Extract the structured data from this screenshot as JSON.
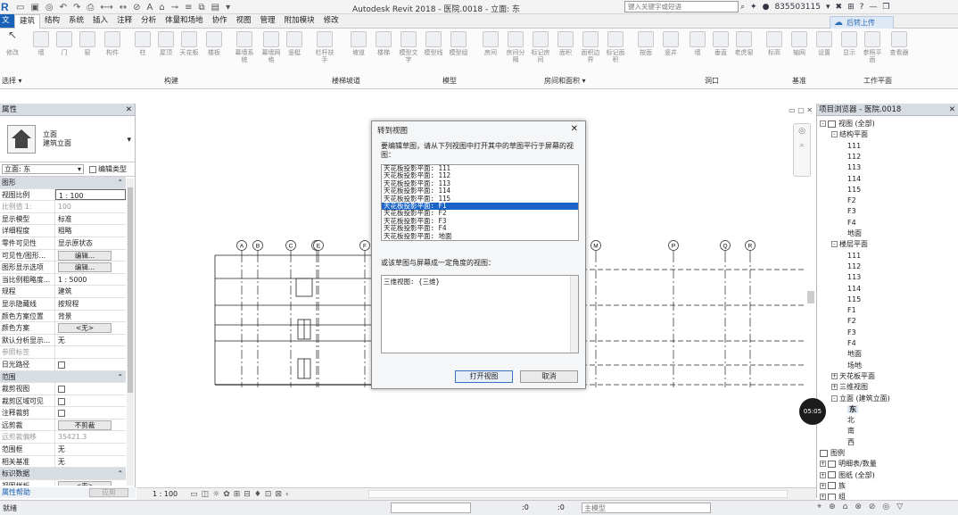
{
  "app": {
    "title": "Autodesk Revit 2018 -  医院.0018 - 立面: 东",
    "search_placeholder": "键入关键字或短语",
    "user": "835503115",
    "upload_label": "后转上传"
  },
  "tabs": [
    "建筑",
    "结构",
    "系统",
    "插入",
    "注释",
    "分析",
    "体量和场地",
    "协作",
    "视图",
    "管理",
    "附加模块",
    "修改"
  ],
  "active_tab_index": 0,
  "ribbon": {
    "modify": "修改",
    "buttons": [
      "墙",
      "门",
      "窗",
      "构件",
      "柱",
      "屋顶",
      "天花板",
      "楼板",
      "幕墙系统",
      "幕墙网格",
      "竖梃",
      "栏杆扶手",
      "坡道",
      "楼梯",
      "模型文字",
      "模型线",
      "模型组",
      "房间",
      "房间分隔",
      "标记房间",
      "面积",
      "面积边界",
      "标记面积",
      "按面",
      "竖井",
      "墙",
      "垂直",
      "老虎窗",
      "标高",
      "轴网",
      "设置",
      "显示",
      "参照平面",
      "查看器"
    ],
    "panels": [
      "选择 ▾",
      "构建",
      "楼梯坡道",
      "模型",
      "房间和面积 ▾",
      "洞口",
      "基准",
      "工作平面"
    ]
  },
  "properties": {
    "title": "属性",
    "type_name": "立面",
    "type_sub": "建筑立面",
    "instance": "立面: 东",
    "edit_type": "编辑类型",
    "rows": [
      {
        "k": "图形",
        "v": "",
        "kind": "sec"
      },
      {
        "k": "视图比例",
        "v": "1 : 100"
      },
      {
        "k": "比例值 1:",
        "v": "100",
        "kind": "grey"
      },
      {
        "k": "显示模型",
        "v": "标准"
      },
      {
        "k": "详细程度",
        "v": "粗略"
      },
      {
        "k": "零件可见性",
        "v": "显示原状态"
      },
      {
        "k": "可见性/图形...",
        "v": "编辑...",
        "kind": "btn"
      },
      {
        "k": "图形显示选项",
        "v": "编辑...",
        "kind": "btn"
      },
      {
        "k": "当比例粗略度...",
        "v": "1 : 5000"
      },
      {
        "k": "规程",
        "v": "建筑"
      },
      {
        "k": "显示隐藏线",
        "v": "按规程"
      },
      {
        "k": "颜色方案位置",
        "v": "背景"
      },
      {
        "k": "颜色方案",
        "v": "<无>",
        "kind": "btn"
      },
      {
        "k": "默认分析显示...",
        "v": "无"
      },
      {
        "k": "参照标签",
        "v": "",
        "kind": "grey"
      },
      {
        "k": "日光路径",
        "v": "",
        "kind": "cb"
      },
      {
        "k": "范围",
        "v": "",
        "kind": "sec"
      },
      {
        "k": "裁剪视图",
        "v": "",
        "kind": "cb"
      },
      {
        "k": "裁剪区域可见",
        "v": "",
        "kind": "cb"
      },
      {
        "k": "注释裁剪",
        "v": "",
        "kind": "cb"
      },
      {
        "k": "远剪裁",
        "v": "不剪裁",
        "kind": "btn"
      },
      {
        "k": "远剪裁偏移",
        "v": "35421.3",
        "kind": "grey"
      },
      {
        "k": "范围框",
        "v": "无"
      },
      {
        "k": "相关基准",
        "v": "无"
      },
      {
        "k": "标识数据",
        "v": "",
        "kind": "sec"
      },
      {
        "k": "视图样板",
        "v": "<无>",
        "kind": "btn"
      }
    ],
    "help": "属性帮助",
    "apply": "应用"
  },
  "browser": {
    "title": "项目浏览器 - 医院.0018",
    "tree": [
      {
        "t": "视图 (全部)",
        "lvl": 0,
        "exp": "-"
      },
      {
        "t": "结构平面",
        "lvl": 1,
        "exp": "-"
      },
      {
        "t": "111",
        "lvl": 2
      },
      {
        "t": "112",
        "lvl": 2
      },
      {
        "t": "113",
        "lvl": 2
      },
      {
        "t": "114",
        "lvl": 2
      },
      {
        "t": "115",
        "lvl": 2
      },
      {
        "t": "F2",
        "lvl": 2
      },
      {
        "t": "F3",
        "lvl": 2
      },
      {
        "t": "F4",
        "lvl": 2
      },
      {
        "t": "地面",
        "lvl": 2
      },
      {
        "t": "楼层平面",
        "lvl": 1,
        "exp": "-"
      },
      {
        "t": "111",
        "lvl": 2
      },
      {
        "t": "112",
        "lvl": 2
      },
      {
        "t": "113",
        "lvl": 2
      },
      {
        "t": "114",
        "lvl": 2
      },
      {
        "t": "115",
        "lvl": 2
      },
      {
        "t": "F1",
        "lvl": 2
      },
      {
        "t": "F2",
        "lvl": 2
      },
      {
        "t": "F3",
        "lvl": 2
      },
      {
        "t": "F4",
        "lvl": 2
      },
      {
        "t": "地面",
        "lvl": 2
      },
      {
        "t": "场地",
        "lvl": 2
      },
      {
        "t": "天花板平面",
        "lvl": 1,
        "exp": "+"
      },
      {
        "t": "三维视图",
        "lvl": 1,
        "exp": "+"
      },
      {
        "t": "立面 (建筑立面)",
        "lvl": 1,
        "exp": "-"
      },
      {
        "t": "东",
        "lvl": 2,
        "sel": true
      },
      {
        "t": "北",
        "lvl": 2
      },
      {
        "t": "南",
        "lvl": 2
      },
      {
        "t": "西",
        "lvl": 2
      },
      {
        "t": "图例",
        "lvl": 0
      },
      {
        "t": "明细表/数量",
        "lvl": 0,
        "exp": "+"
      },
      {
        "t": "图纸 (全部)",
        "lvl": 0,
        "exp": "+"
      },
      {
        "t": "族",
        "lvl": 0,
        "exp": "+"
      },
      {
        "t": "组",
        "lvl": 0,
        "exp": "+"
      }
    ]
  },
  "grid_labels": [
    "A",
    "B",
    "C",
    "D",
    "E",
    "F",
    "M",
    "P",
    "Q",
    "R"
  ],
  "dialog": {
    "title": "转到视图",
    "prompt": "要编辑草图，请从下列视图中打开其中的草图平行于屏幕的视图：",
    "list": [
      "天花板投影平面: 111",
      "天花板投影平面: 112",
      "天花板投影平面: 113",
      "天花板投影平面: 114",
      "天花板投影平面: 115",
      "天花板投影平面: F1",
      "天花板投影平面: F2",
      "天花板投影平面: F3",
      "天花板投影平面: F4",
      "天花板投影平面: 地面"
    ],
    "selected_index": 5,
    "prompt2": "或该草图与屏幕成一定角度的视图：",
    "list2": [
      "三维视图: {三维}"
    ],
    "open": "打开视图",
    "cancel": "取消"
  },
  "view_control": {
    "scale": "1 : 100"
  },
  "status": {
    "text": "就绪",
    "zero1": ":0",
    "zero2": ":0",
    "model": "主模型"
  },
  "timer": "05:05"
}
